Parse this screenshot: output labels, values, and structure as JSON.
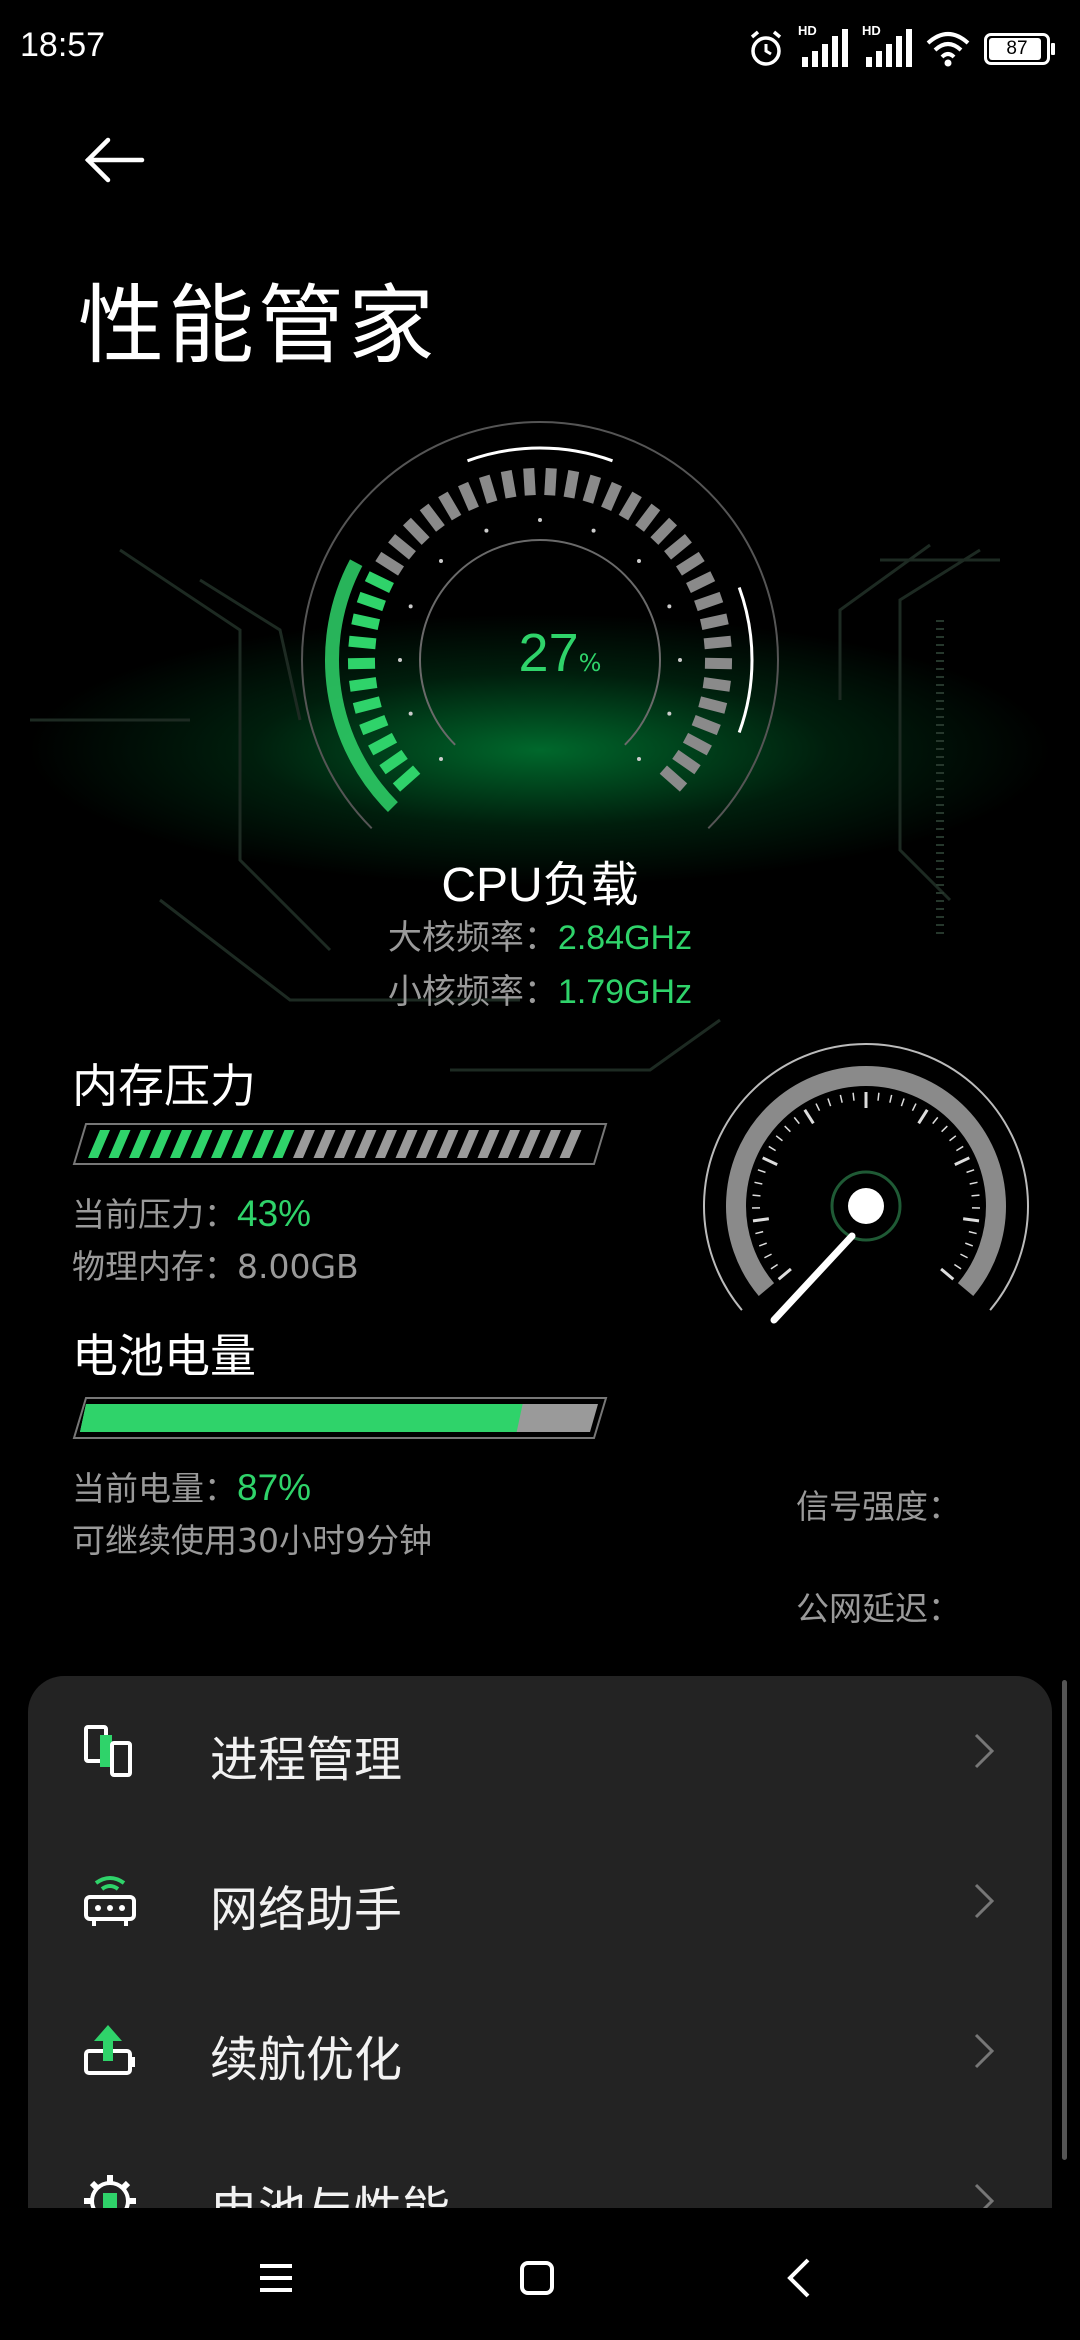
{
  "status_bar": {
    "time": "18:57",
    "network_badge_1": "HD",
    "network_badge_2": "HD",
    "battery_level": "87",
    "icons": [
      "alarm-icon",
      "signal-icon",
      "signal-icon",
      "wifi-icon",
      "battery-icon"
    ]
  },
  "header": {
    "back_icon": "arrow-left-icon",
    "title": "性能管家"
  },
  "cpu": {
    "load_value": "27",
    "load_unit": "%",
    "load_fraction": 0.27,
    "label": "CPU负载",
    "big_core_label": "大核频率：",
    "big_core_value": "2.84GHz",
    "small_core_label": "小核频率：",
    "small_core_value": "1.79GHz"
  },
  "memory": {
    "title": "内存压力",
    "pressure_label": "当前压力：",
    "pressure_value": "43%",
    "pressure_fraction": 0.43,
    "physical_label": "物理内存：",
    "physical_value": "8.00GB"
  },
  "battery": {
    "title": "电池电量",
    "level_label": "当前电量：",
    "level_value": "87%",
    "level_fraction": 0.87,
    "remaining": "可继续使用30小时9分钟"
  },
  "network": {
    "signal_label": "信号强度：",
    "latency_label": "公网延迟："
  },
  "menu": {
    "items": [
      {
        "label": "进程管理",
        "icon": "process-manager-icon"
      },
      {
        "label": "网络助手",
        "icon": "router-icon"
      },
      {
        "label": "续航优化",
        "icon": "battery-boost-icon"
      },
      {
        "label": "电池与性能",
        "icon": "gear-battery-icon"
      }
    ]
  },
  "nav_bar": {
    "icons": [
      "menu-icon",
      "home-icon",
      "back-icon"
    ]
  },
  "colors": {
    "accent_green": "#2fd36a",
    "background": "#000000",
    "card": "#232323",
    "muted_text": "#9a9a9a"
  }
}
